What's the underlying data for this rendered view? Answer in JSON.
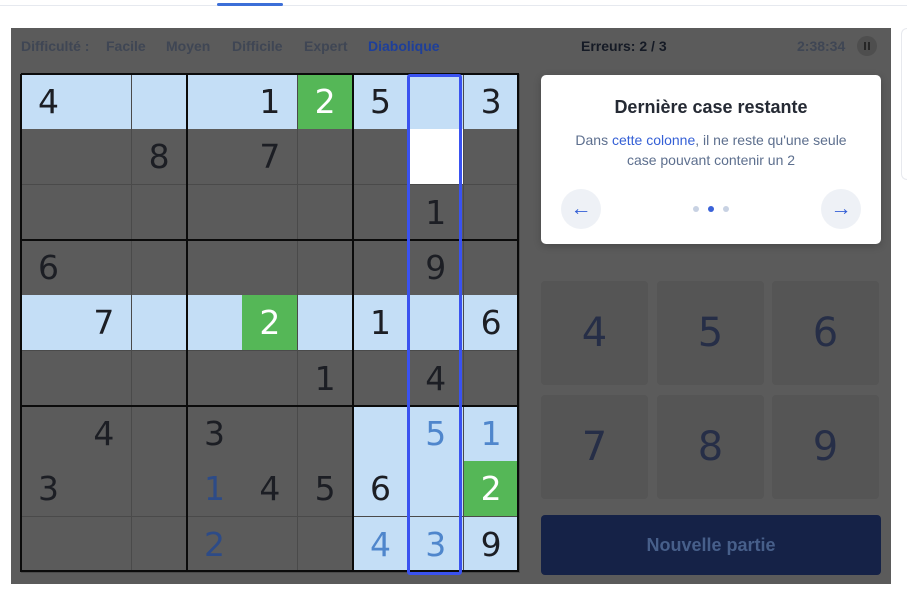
{
  "header": {
    "difficulty_label": "Difficulté :",
    "difficulties": [
      "Facile",
      "Moyen",
      "Difficile",
      "Expert",
      "Diabolique"
    ],
    "active_difficulty": "Diabolique",
    "errors": "Erreurs: 2 / 3",
    "timer": "2:38:34"
  },
  "board": {
    "rows": [
      [
        "4",
        "",
        "",
        "",
        "1",
        "2",
        "5",
        "",
        "3"
      ],
      [
        "",
        "",
        "8",
        "",
        "7",
        "",
        "",
        "",
        ""
      ],
      [
        "",
        "",
        "",
        "",
        "",
        "",
        "",
        "1",
        ""
      ],
      [
        "6",
        "",
        "",
        "",
        "",
        "",
        "",
        "9",
        ""
      ],
      [
        "",
        "7",
        "",
        "",
        "2",
        "",
        "1",
        "",
        "6"
      ],
      [
        "",
        "",
        "",
        "",
        "",
        "1",
        "",
        "4",
        ""
      ],
      [
        "",
        "4",
        "",
        "3",
        "",
        "",
        "",
        "5",
        "1"
      ],
      [
        "3",
        "",
        "",
        "1",
        "4",
        "5",
        "6",
        "",
        "2"
      ],
      [
        "",
        "",
        "",
        "2",
        "",
        "",
        "4",
        "3",
        "9"
      ]
    ],
    "highlighted_cells": [
      [
        0,
        0
      ],
      [
        0,
        1
      ],
      [
        0,
        2
      ],
      [
        0,
        3
      ],
      [
        0,
        4
      ],
      [
        0,
        6
      ],
      [
        0,
        7
      ],
      [
        0,
        8
      ],
      [
        4,
        0
      ],
      [
        4,
        1
      ],
      [
        4,
        2
      ],
      [
        4,
        3
      ],
      [
        4,
        5
      ],
      [
        4,
        6
      ],
      [
        4,
        7
      ],
      [
        4,
        8
      ],
      [
        6,
        6
      ],
      [
        6,
        7
      ],
      [
        6,
        8
      ],
      [
        7,
        6
      ],
      [
        7,
        7
      ],
      [
        8,
        6
      ],
      [
        8,
        7
      ],
      [
        8,
        8
      ]
    ],
    "green_cells": [
      [
        0,
        5
      ],
      [
        4,
        4
      ],
      [
        7,
        8
      ]
    ],
    "target_cell": [
      1,
      7
    ],
    "user_filled_cells": [
      [
        6,
        7
      ],
      [
        6,
        8
      ],
      [
        7,
        3
      ],
      [
        8,
        3
      ],
      [
        8,
        6
      ],
      [
        8,
        7
      ]
    ],
    "focus_column": 7
  },
  "numpad": {
    "keys": [
      "4",
      "5",
      "6",
      "7",
      "8",
      "9"
    ]
  },
  "new_game_label": "Nouvelle partie",
  "hint": {
    "title": "Dernière case restante",
    "text_before": "Dans ",
    "link_text": "cette colonne",
    "text_after": ", il ne reste qu'une seule case pouvant contenir un 2",
    "prev_icon": "arrow-left-icon",
    "next_icon": "arrow-right-icon",
    "page_count": 3,
    "current_page": 2
  },
  "colors": {
    "highlight": "#c4def6",
    "correct_green": "#55b757",
    "focus_frame": "#3a52f0",
    "accent_blue": "#3560d6"
  }
}
